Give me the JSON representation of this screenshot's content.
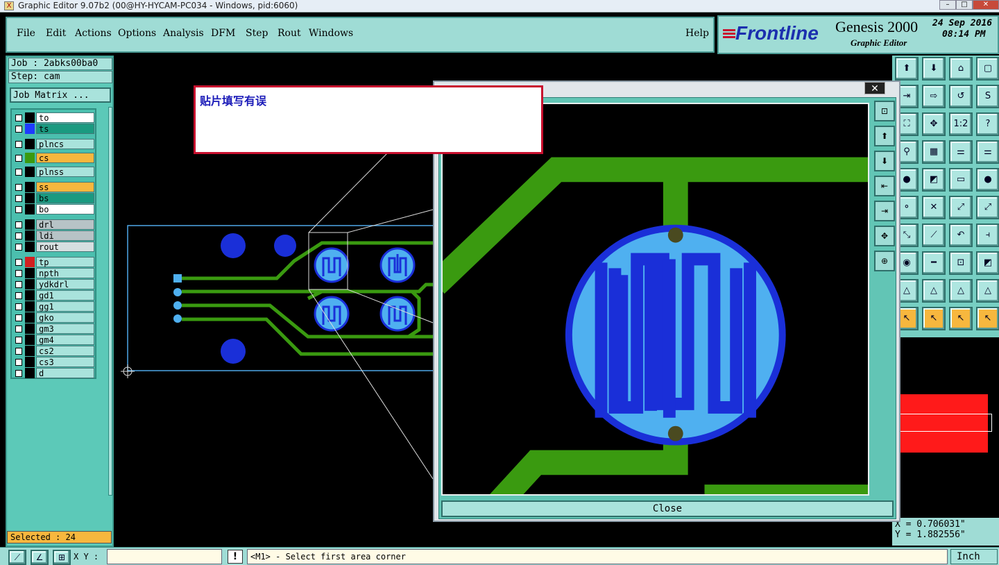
{
  "window": {
    "title": "Graphic Editor 9.07b2 (00@HY-HYCAM-PC034 - Windows, pid:6060)",
    "app_icon": "X",
    "min": "–",
    "max": "□",
    "close": "✕"
  },
  "menu": {
    "items": [
      "File",
      "Edit",
      "Actions",
      "Options",
      "Analysis",
      "DFM",
      "Step",
      "Rout",
      "Windows"
    ],
    "help": "Help"
  },
  "logo": {
    "brand": "Frontline",
    "product": "Genesis 2000",
    "subtitle": "Graphic Editor",
    "date": "24 Sep 2016",
    "time": "08:14 PM"
  },
  "left": {
    "job": "Job : 2abks00ba0",
    "step": "Step: cam",
    "job_matrix": "Job Matrix ...",
    "selected": "Selected : 24",
    "layers": [
      {
        "name": "to",
        "color": "#ffffff",
        "swatch": "#000000"
      },
      {
        "name": "ts",
        "color": "#1a9a80",
        "swatch": "#1f3bff"
      },
      {
        "name": "plncs",
        "color": "#a9e3dc",
        "swatch": "#000000"
      },
      {
        "name": "cs",
        "color": "#f7b73e",
        "swatch": "#3a9a10"
      },
      {
        "name": "plnss",
        "color": "#a9e3dc",
        "swatch": "#000000"
      },
      {
        "name": "ss",
        "color": "#f7b73e",
        "swatch": "#000000"
      },
      {
        "name": "bs",
        "color": "#1a9a80",
        "swatch": "#000000"
      },
      {
        "name": "bo",
        "color": "#ffffff",
        "swatch": "#000000"
      },
      {
        "name": "drl",
        "color": "#b7c3c6",
        "swatch": "#000000"
      },
      {
        "name": "ldi",
        "color": "#b7c3c6",
        "swatch": "#000000"
      },
      {
        "name": "rout",
        "color": "#d6dfe0",
        "swatch": "#000000"
      },
      {
        "name": "tp",
        "color": "#a9e3dc",
        "swatch": "#d22020"
      },
      {
        "name": "npth",
        "color": "#a9e3dc",
        "swatch": "#000000"
      },
      {
        "name": "ydkdrl",
        "color": "#a9e3dc",
        "swatch": "#000000"
      },
      {
        "name": "gd1",
        "color": "#a9e3dc",
        "swatch": "#000000"
      },
      {
        "name": "gg1",
        "color": "#a9e3dc",
        "swatch": "#000000"
      },
      {
        "name": "gko",
        "color": "#a9e3dc",
        "swatch": "#000000"
      },
      {
        "name": "gm3",
        "color": "#a9e3dc",
        "swatch": "#000000"
      },
      {
        "name": "gm4",
        "color": "#a9e3dc",
        "swatch": "#000000"
      },
      {
        "name": "cs2",
        "color": "#a9e3dc",
        "swatch": "#000000"
      },
      {
        "name": "cs3",
        "color": "#a9e3dc",
        "swatch": "#000000"
      },
      {
        "name": "d",
        "color": "#a9e3dc",
        "swatch": "#000000"
      }
    ]
  },
  "error_popup": {
    "message": "贴片填写有误"
  },
  "zoom_window": {
    "close_label": "Close",
    "title_close": "✕"
  },
  "coords": {
    "x": "X = 0.706031\"",
    "y": "Y = 1.882556\""
  },
  "status": {
    "xy_label": "X Y :",
    "xy_value": "",
    "prompt": "<M1> - Select first area corner",
    "units": "Inch",
    "warn": "!"
  },
  "toolbar": {
    "icons": [
      "panel-up",
      "panel-down",
      "home",
      "window",
      "route",
      "export",
      "loop",
      "flip",
      "frame",
      "pan",
      "scale-1-2",
      "help",
      "probe",
      "grid",
      "net-a",
      "net-b",
      "pad",
      "flag",
      "ruler",
      "dot",
      "dots-a",
      "cross",
      "diag-a",
      "diag-b",
      "arrow-a",
      "diag-c",
      "curve",
      "pipe",
      "circle-a",
      "bar",
      "box",
      "mix",
      "tri-a",
      "tri-b",
      "tri-c",
      "tri-d",
      "pointer-a",
      "pointer-b",
      "pointer-c",
      "pointer-d"
    ],
    "scale_label": "1:2"
  },
  "colors": {
    "teal": "#9fdcd5",
    "trace": "#3a9a10",
    "pad": "#4fb0f0",
    "pad_edge": "#1a2fd8",
    "error_border": "#c8102e"
  }
}
